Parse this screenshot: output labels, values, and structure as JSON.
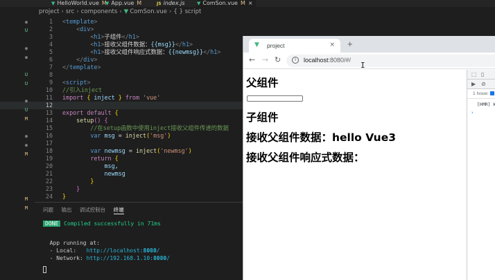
{
  "editor": {
    "tabs": [
      {
        "label": "HelloWorld.vue",
        "badge": "M",
        "icon": "vue-icon"
      },
      {
        "label": "App.vue",
        "badge": "M",
        "icon": "vue-icon"
      },
      {
        "label": "index.js",
        "badge": "",
        "icon": "js-icon"
      },
      {
        "label": "ComSon.vue",
        "badge": "M",
        "icon": "vue-icon",
        "close": "×"
      }
    ],
    "breadcrumb": [
      "project",
      "src",
      "components",
      "ComSon.vue",
      "script"
    ],
    "breadcrumb_braces": "{ }",
    "gutter": [
      "●",
      "U",
      "●",
      "●",
      "U",
      "U",
      "●",
      "U",
      "M",
      "●",
      "●",
      "M",
      "M",
      "M"
    ],
    "lines": [
      "1",
      "2",
      "3",
      "4",
      "5",
      "6",
      "7",
      "8",
      "9",
      "10",
      "11",
      "12",
      "13",
      "14",
      "15",
      "16",
      "17",
      "18",
      "19",
      "20",
      "21",
      "22",
      "23",
      "24"
    ],
    "code": {
      "template_open": "template",
      "div": "div",
      "h1": "h1",
      "h1_text": "子组件",
      "h2_text": "接收父组件数据：",
      "h2_mustache": "{{msg}}",
      "h3_text": "接收父组件响应式数据：",
      "h3_mustache": "{{newmsg}}",
      "script": "script",
      "comment1": "//引入inject",
      "import_kw": "import",
      "inject": "inject",
      "from_kw": "from",
      "vue_str": "'vue'",
      "export_kw": "export",
      "default_kw": "default",
      "setup": "setup",
      "comment2": "//在setup函数中使用inject接收父组件传递的数据",
      "var_kw": "var",
      "msg_var": "msg",
      "msg_str": "'msg'",
      "newmsg_var": "newmsg",
      "newmsg_str": "'newmsg'",
      "return_kw": "return",
      "ret_msg": "msg,",
      "ret_newmsg": "newmsg"
    }
  },
  "panel": {
    "tabs": [
      "问题",
      "输出",
      "调试控制台",
      "终端"
    ],
    "done_badge": "DONE",
    "compiled": "Compiled successfully in 71ms",
    "running": "App running at:",
    "local_label": "- Local:   ",
    "local_url": "http://localhost:",
    "local_port": "8080",
    "network_label": "- Network: ",
    "network_url": "http://192.168.1.10:",
    "network_port": "8080"
  },
  "browser": {
    "tab_title": "project",
    "tab_close": "×",
    "new_tab": "+",
    "url_host": "localhost",
    "url_rest": ":8080/#/",
    "page": {
      "parent_title": "父组件",
      "child_title": "子组件",
      "received": "接收父组件数据：hello Vue3",
      "received_reactive": "接收父组件响应式数据："
    },
    "devtools": {
      "issues": "1 Issue:",
      "log": "[HMR] W",
      "prompt": "›"
    }
  }
}
